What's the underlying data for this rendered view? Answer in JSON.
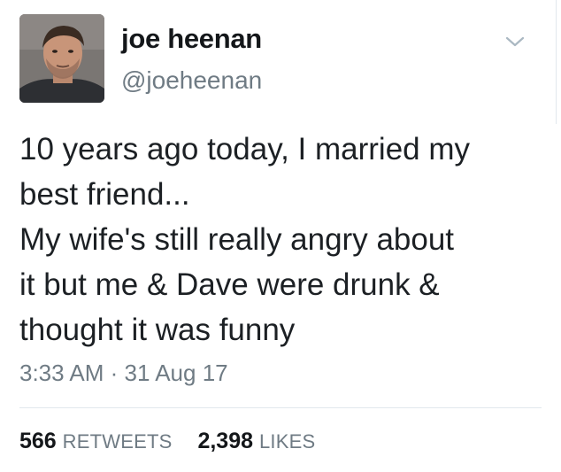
{
  "tweet": {
    "author": {
      "display_name": "joe heenan",
      "handle": "@joeheenan"
    },
    "menu_icon": "chevron-down-icon",
    "text_lines": [
      "10 years ago today, I married my",
      "best friend...",
      "My wife's still really angry about",
      "it but me & Dave were drunk &",
      "thought it was funny"
    ],
    "timestamp": "3:33 AM · 31 Aug 17",
    "stats": {
      "retweets": {
        "count": "566",
        "label": "RETWEETS"
      },
      "likes": {
        "count": "2,398",
        "label": "LIKES"
      }
    }
  },
  "colors": {
    "text": "#14171a",
    "secondary": "#6f7b84",
    "divider": "#e1e8ed"
  }
}
